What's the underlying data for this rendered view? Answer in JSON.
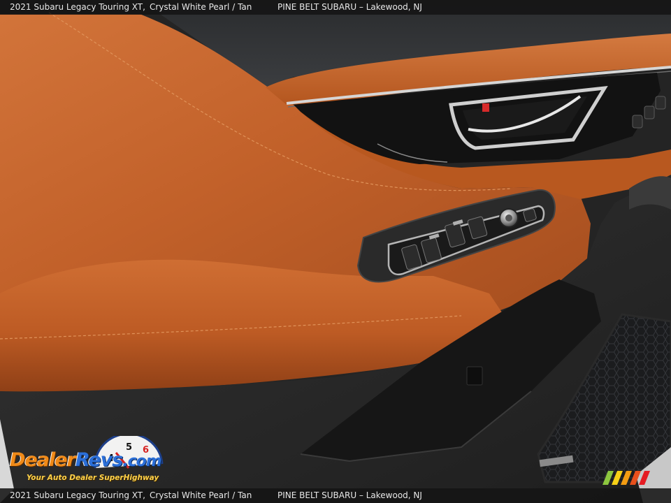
{
  "caption": {
    "model": "2021 Subaru Legacy Touring XT,",
    "color": "Crystal White Pearl / Tan",
    "dealer": "PINE BELT SUBARU – Lakewood, NJ"
  },
  "watermark": {
    "brand_part1": "Dealer",
    "brand_part2": "Revs",
    "brand_suffix": ".com",
    "tagline": "Your Auto Dealer SuperHighway",
    "gauge_digits": [
      "4",
      "5",
      "6"
    ]
  },
  "colors": {
    "leather_tan": "#c2612a",
    "leather_shadow": "#8e3f16",
    "door_black": "#262626",
    "chrome": "#c9c9c9",
    "caption_bg": "#141414",
    "brand_orange": "#f08a18",
    "brand_blue": "#2b6fd8",
    "tagline_yellow": "#ffd24a",
    "stripe_colors": [
      "#8cc63f",
      "#f7d117",
      "#f39c12",
      "#e8501c",
      "#e51c23"
    ]
  },
  "icons": [
    "speedometer-gauge-icon",
    "color-stripes-icon",
    "window-switch-icon",
    "mirror-knob-icon",
    "door-handle-icon"
  ]
}
